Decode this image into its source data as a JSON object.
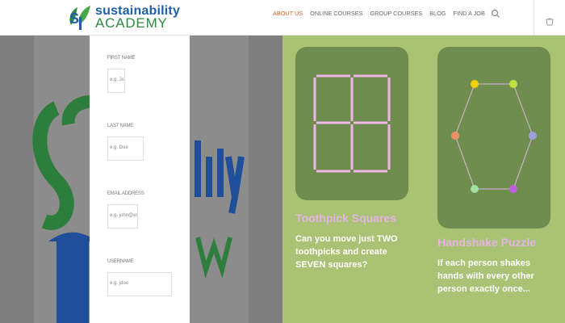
{
  "brand": {
    "line1": "sustainability",
    "line2": "ACADEMY",
    "colors": {
      "blue": "#1e5fa8",
      "green": "#2d8a3e",
      "accent": "#e0641f"
    }
  },
  "nav": {
    "items": [
      {
        "label": "ABOUT US",
        "active": true
      },
      {
        "label": "ONLINE COURSES",
        "active": false
      },
      {
        "label": "GROUP COURSES",
        "active": false
      },
      {
        "label": "BLOG",
        "active": false
      },
      {
        "label": "FIND A JOB",
        "active": false
      }
    ],
    "search_icon": "search-icon",
    "cart_icon": "cart-icon"
  },
  "form": {
    "fields": [
      {
        "label": "FIRST NAME",
        "value": "e.g. John"
      },
      {
        "label": "LAST NAME",
        "value": "e.g. Doe"
      },
      {
        "label": "EMAIL ADDRESS",
        "value": "e.g. john@example.com"
      },
      {
        "label": "USERNAME",
        "value": "e.g. jdoe"
      }
    ]
  },
  "puzzles": [
    {
      "title": "Toothpick Squares",
      "description": "Can you move just TWO toothpicks and create SEVEN squares?"
    },
    {
      "title": "Handshake Puzzle",
      "description": "If each person shakes hands with every other person exactly once..."
    }
  ]
}
